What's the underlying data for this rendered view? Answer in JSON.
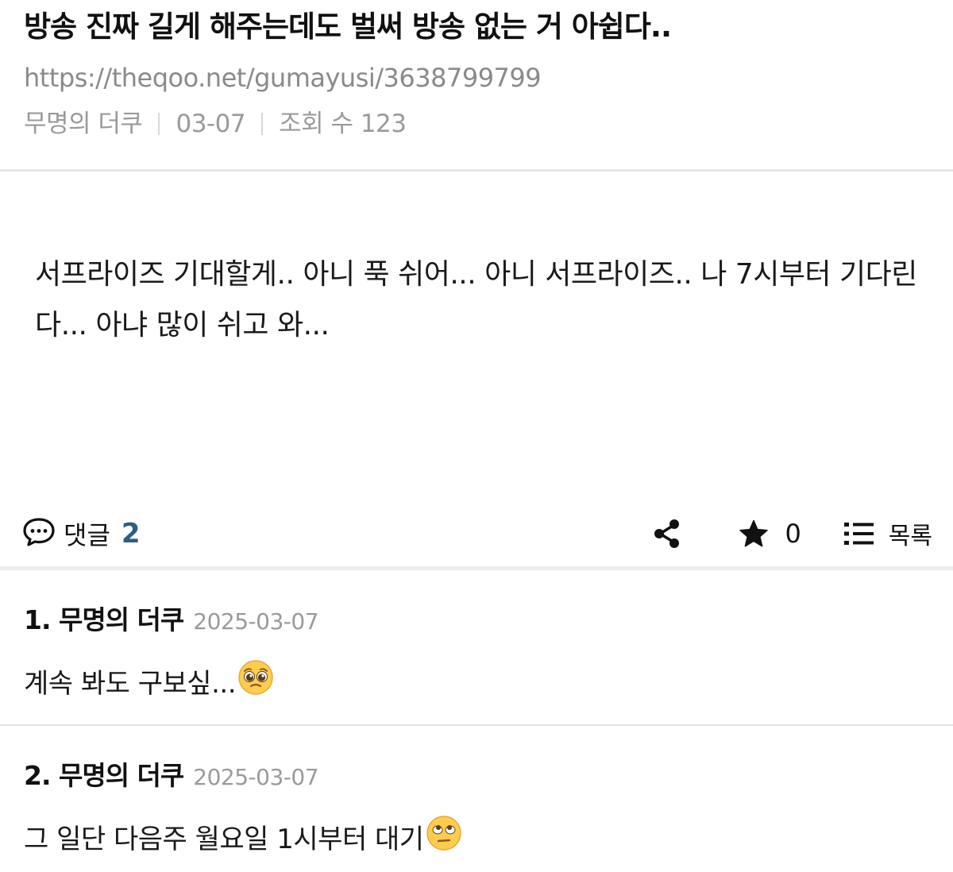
{
  "post": {
    "title": "방송 진짜 길게 해주는데도 벌써 방송 없는 거 아쉽다..",
    "url": "https://theqoo.net/gumayusi/3638799799",
    "author": "무명의 더쿠",
    "date": "03-07",
    "views": "조회 수 123",
    "body": "서프라이즈 기대할게.. 아니 푹 쉬어... 아니 서프라이즈.. 나 7시부터 기다린다... 아냐 많이 쉬고 와..."
  },
  "actions": {
    "comment_label": "댓글",
    "comment_count": "2",
    "star_count": "0",
    "list_label": "목록",
    "icons": [
      "speech-bubble-icon",
      "share-icon",
      "star-icon",
      "list-icon"
    ]
  },
  "comments": [
    {
      "author": "1. 무명의 더쿠",
      "date": "2025-03-07",
      "text": "계속 봐도 구보싶...",
      "emoji": "pleading-face-icon"
    },
    {
      "author": "2. 무명의 더쿠",
      "date": "2025-03-07",
      "text": "그 일단 다음주 월요일 1시부터 대기",
      "emoji": "eye-roll-face-icon"
    }
  ],
  "colors": {
    "accent": "#2d5d86",
    "muted": "#9a9a9a",
    "divider": "#e6e6e6"
  }
}
